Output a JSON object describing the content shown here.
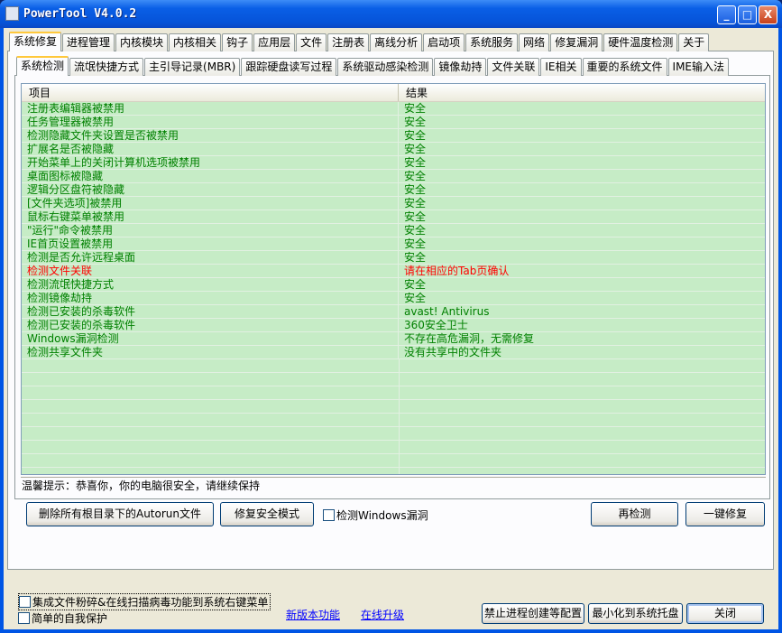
{
  "window": {
    "title": "PowerTool V4.0.2",
    "minimize": "_",
    "maximize": "□",
    "close": "X"
  },
  "main_tabs": [
    "系统修复",
    "进程管理",
    "内核模块",
    "内核相关",
    "钩子",
    "应用层",
    "文件",
    "注册表",
    "离线分析",
    "启动项",
    "系统服务",
    "网络",
    "修复漏洞",
    "硬件温度检测",
    "关于"
  ],
  "sub_tabs": [
    "系统检测",
    "流氓快捷方式",
    "主引导记录(MBR)",
    "跟踪硬盘读写过程",
    "系统驱动感染检测",
    "镜像劫持",
    "文件关联",
    "IE相关",
    "重要的系统文件",
    "IME输入法"
  ],
  "list": {
    "columns": [
      "项目",
      "结果"
    ],
    "rows": [
      {
        "item": "注册表编辑器被禁用",
        "result": "安全",
        "status": "ok"
      },
      {
        "item": "任务管理器被禁用",
        "result": "安全",
        "status": "ok"
      },
      {
        "item": "检测隐藏文件夹设置是否被禁用",
        "result": "安全",
        "status": "ok"
      },
      {
        "item": "扩展名是否被隐藏",
        "result": "安全",
        "status": "ok"
      },
      {
        "item": "开始菜单上的关闭计算机选项被禁用",
        "result": "安全",
        "status": "ok"
      },
      {
        "item": "桌面图标被隐藏",
        "result": "安全",
        "status": "ok"
      },
      {
        "item": "逻辑分区盘符被隐藏",
        "result": "安全",
        "status": "ok"
      },
      {
        "item": "[文件夹选项]被禁用",
        "result": "安全",
        "status": "ok"
      },
      {
        "item": "鼠标右键菜单被禁用",
        "result": "安全",
        "status": "ok"
      },
      {
        "item": "\"运行\"命令被禁用",
        "result": "安全",
        "status": "ok"
      },
      {
        "item": "IE首页设置被禁用",
        "result": "安全",
        "status": "ok"
      },
      {
        "item": "检测是否允许远程桌面",
        "result": "安全",
        "status": "ok"
      },
      {
        "item": "检测文件关联",
        "result": "请在相应的Tab页确认",
        "status": "warn"
      },
      {
        "item": "检测流氓快捷方式",
        "result": "安全",
        "status": "ok"
      },
      {
        "item": "检测镜像劫持",
        "result": "安全",
        "status": "ok"
      },
      {
        "item": "检测已安装的杀毒软件",
        "result": "avast! Antivirus",
        "status": "ok"
      },
      {
        "item": "检测已安装的杀毒软件",
        "result": "360安全卫士",
        "status": "ok"
      },
      {
        "item": "Windows漏洞检测",
        "result": "不存在高危漏洞，无需修复",
        "status": "ok"
      },
      {
        "item": "检测共享文件夹",
        "result": "没有共享中的文件夹",
        "status": "ok"
      }
    ],
    "colors": {
      "ok": "#008000",
      "warn": "#ff0000",
      "background": "#c6ecc6"
    }
  },
  "status_text": "温馨提示：恭喜你，你的电脑很安全，请继续保持",
  "buttons": {
    "delete_autorun": "删除所有根目录下的Autorun文件",
    "repair_safe_mode": "修复安全模式",
    "recheck": "再检测",
    "one_click_fix": "一键修复",
    "block_config": "禁止进程创建等配置",
    "minimize_tray": "最小化到系统托盘",
    "close": "关闭"
  },
  "checkboxes": {
    "check_windows_vuln": {
      "label": "检测Windows漏洞",
      "checked": false
    },
    "integrate_menu": {
      "label": "集成文件粉碎&在线扫描病毒功能到系统右键菜单",
      "checked": false
    },
    "self_protect": {
      "label": "简单的自我保护",
      "checked": false
    }
  },
  "links": {
    "new_features": "新版本功能",
    "online_upgrade": "在线升级"
  }
}
